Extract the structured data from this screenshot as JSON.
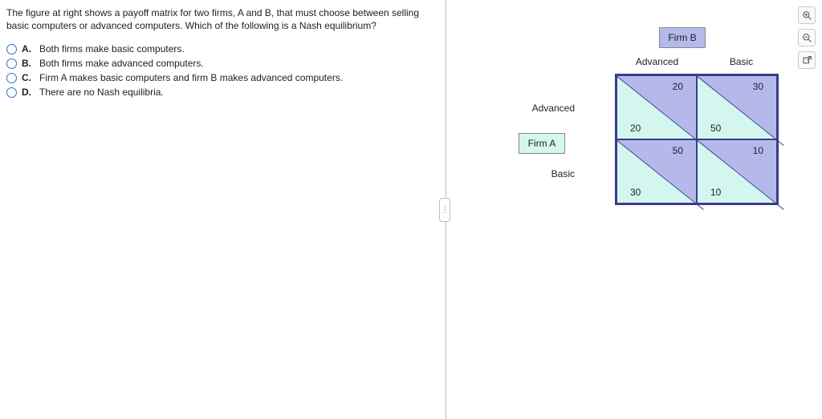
{
  "question": "The figure at right shows a payoff matrix for two firms, A and B, that must choose between selling basic computers or advanced computers. Which of the following is a Nash equilibrium?",
  "options": {
    "A": {
      "letter": "A.",
      "text": "Both firms make basic computers."
    },
    "B": {
      "letter": "B.",
      "text": "Both firms make advanced computers."
    },
    "C": {
      "letter": "C.",
      "text": "Firm A makes basic computers and firm B makes advanced computers."
    },
    "D": {
      "letter": "D.",
      "text": "There are no Nash equilibria."
    }
  },
  "matrix": {
    "firmA_label": "Firm A",
    "firmB_label": "Firm B",
    "col_headers": {
      "left": "Advanced",
      "right": "Basic"
    },
    "row_headers": {
      "top": "Advanced",
      "bottom": "Basic"
    },
    "cells": {
      "aa": {
        "B": "20",
        "A": "20"
      },
      "ab": {
        "B": "30",
        "A": "50"
      },
      "ba": {
        "B": "50",
        "A": "30"
      },
      "bb": {
        "B": "10",
        "A": "10"
      }
    }
  },
  "chart_data": {
    "type": "table",
    "title": "Payoff matrix — Firm A (rows) vs Firm B (columns)",
    "row_player": "Firm A",
    "col_player": "Firm B",
    "row_strategies": [
      "Advanced",
      "Basic"
    ],
    "col_strategies": [
      "Advanced",
      "Basic"
    ],
    "payoffs": [
      [
        {
          "A": 20,
          "B": 20
        },
        {
          "A": 50,
          "B": 30
        }
      ],
      [
        {
          "A": 30,
          "B": 50
        },
        {
          "A": 10,
          "B": 10
        }
      ]
    ]
  }
}
